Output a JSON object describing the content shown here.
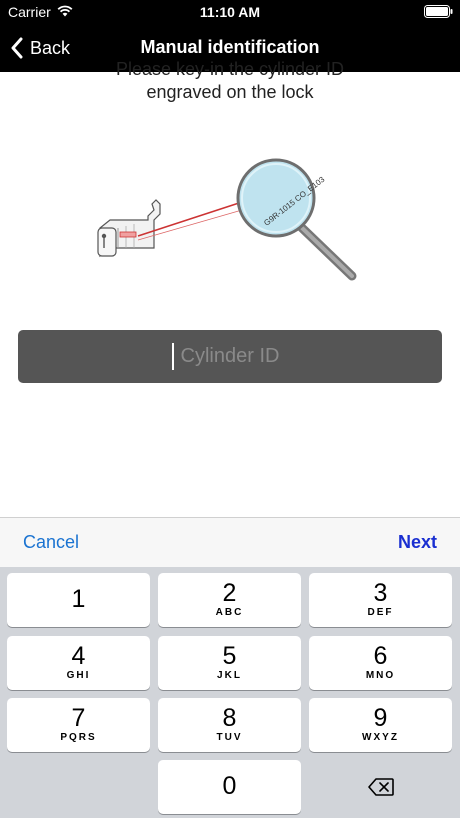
{
  "status_bar": {
    "carrier": "Carrier",
    "time": "11:10 AM"
  },
  "nav": {
    "back_label": "Back",
    "title": "Manual identification"
  },
  "instruction": {
    "line1": "Please key-in the cylinder ID",
    "line2": "engraved on the lock"
  },
  "illustration": {
    "engraving_text": "G9R-1015 CO_E103"
  },
  "id_field": {
    "value": "",
    "placeholder": "Cylinder ID"
  },
  "toolbar": {
    "cancel_label": "Cancel",
    "next_label": "Next"
  },
  "keypad": {
    "keys": [
      {
        "digit": "1",
        "letters": ""
      },
      {
        "digit": "2",
        "letters": "ABC"
      },
      {
        "digit": "3",
        "letters": "DEF"
      },
      {
        "digit": "4",
        "letters": "GHI"
      },
      {
        "digit": "5",
        "letters": "JKL"
      },
      {
        "digit": "6",
        "letters": "MNO"
      },
      {
        "digit": "7",
        "letters": "PQRS"
      },
      {
        "digit": "8",
        "letters": "TUV"
      },
      {
        "digit": "9",
        "letters": "WXYZ"
      },
      {
        "digit": "0",
        "letters": ""
      }
    ],
    "backspace_icon": "backspace-icon"
  },
  "colors": {
    "nav_background": "#000000",
    "field_background": "#555555",
    "accent_blue": "#1a73d1",
    "next_blue": "#1a2fd1",
    "keypad_background": "#d1d4d9"
  }
}
